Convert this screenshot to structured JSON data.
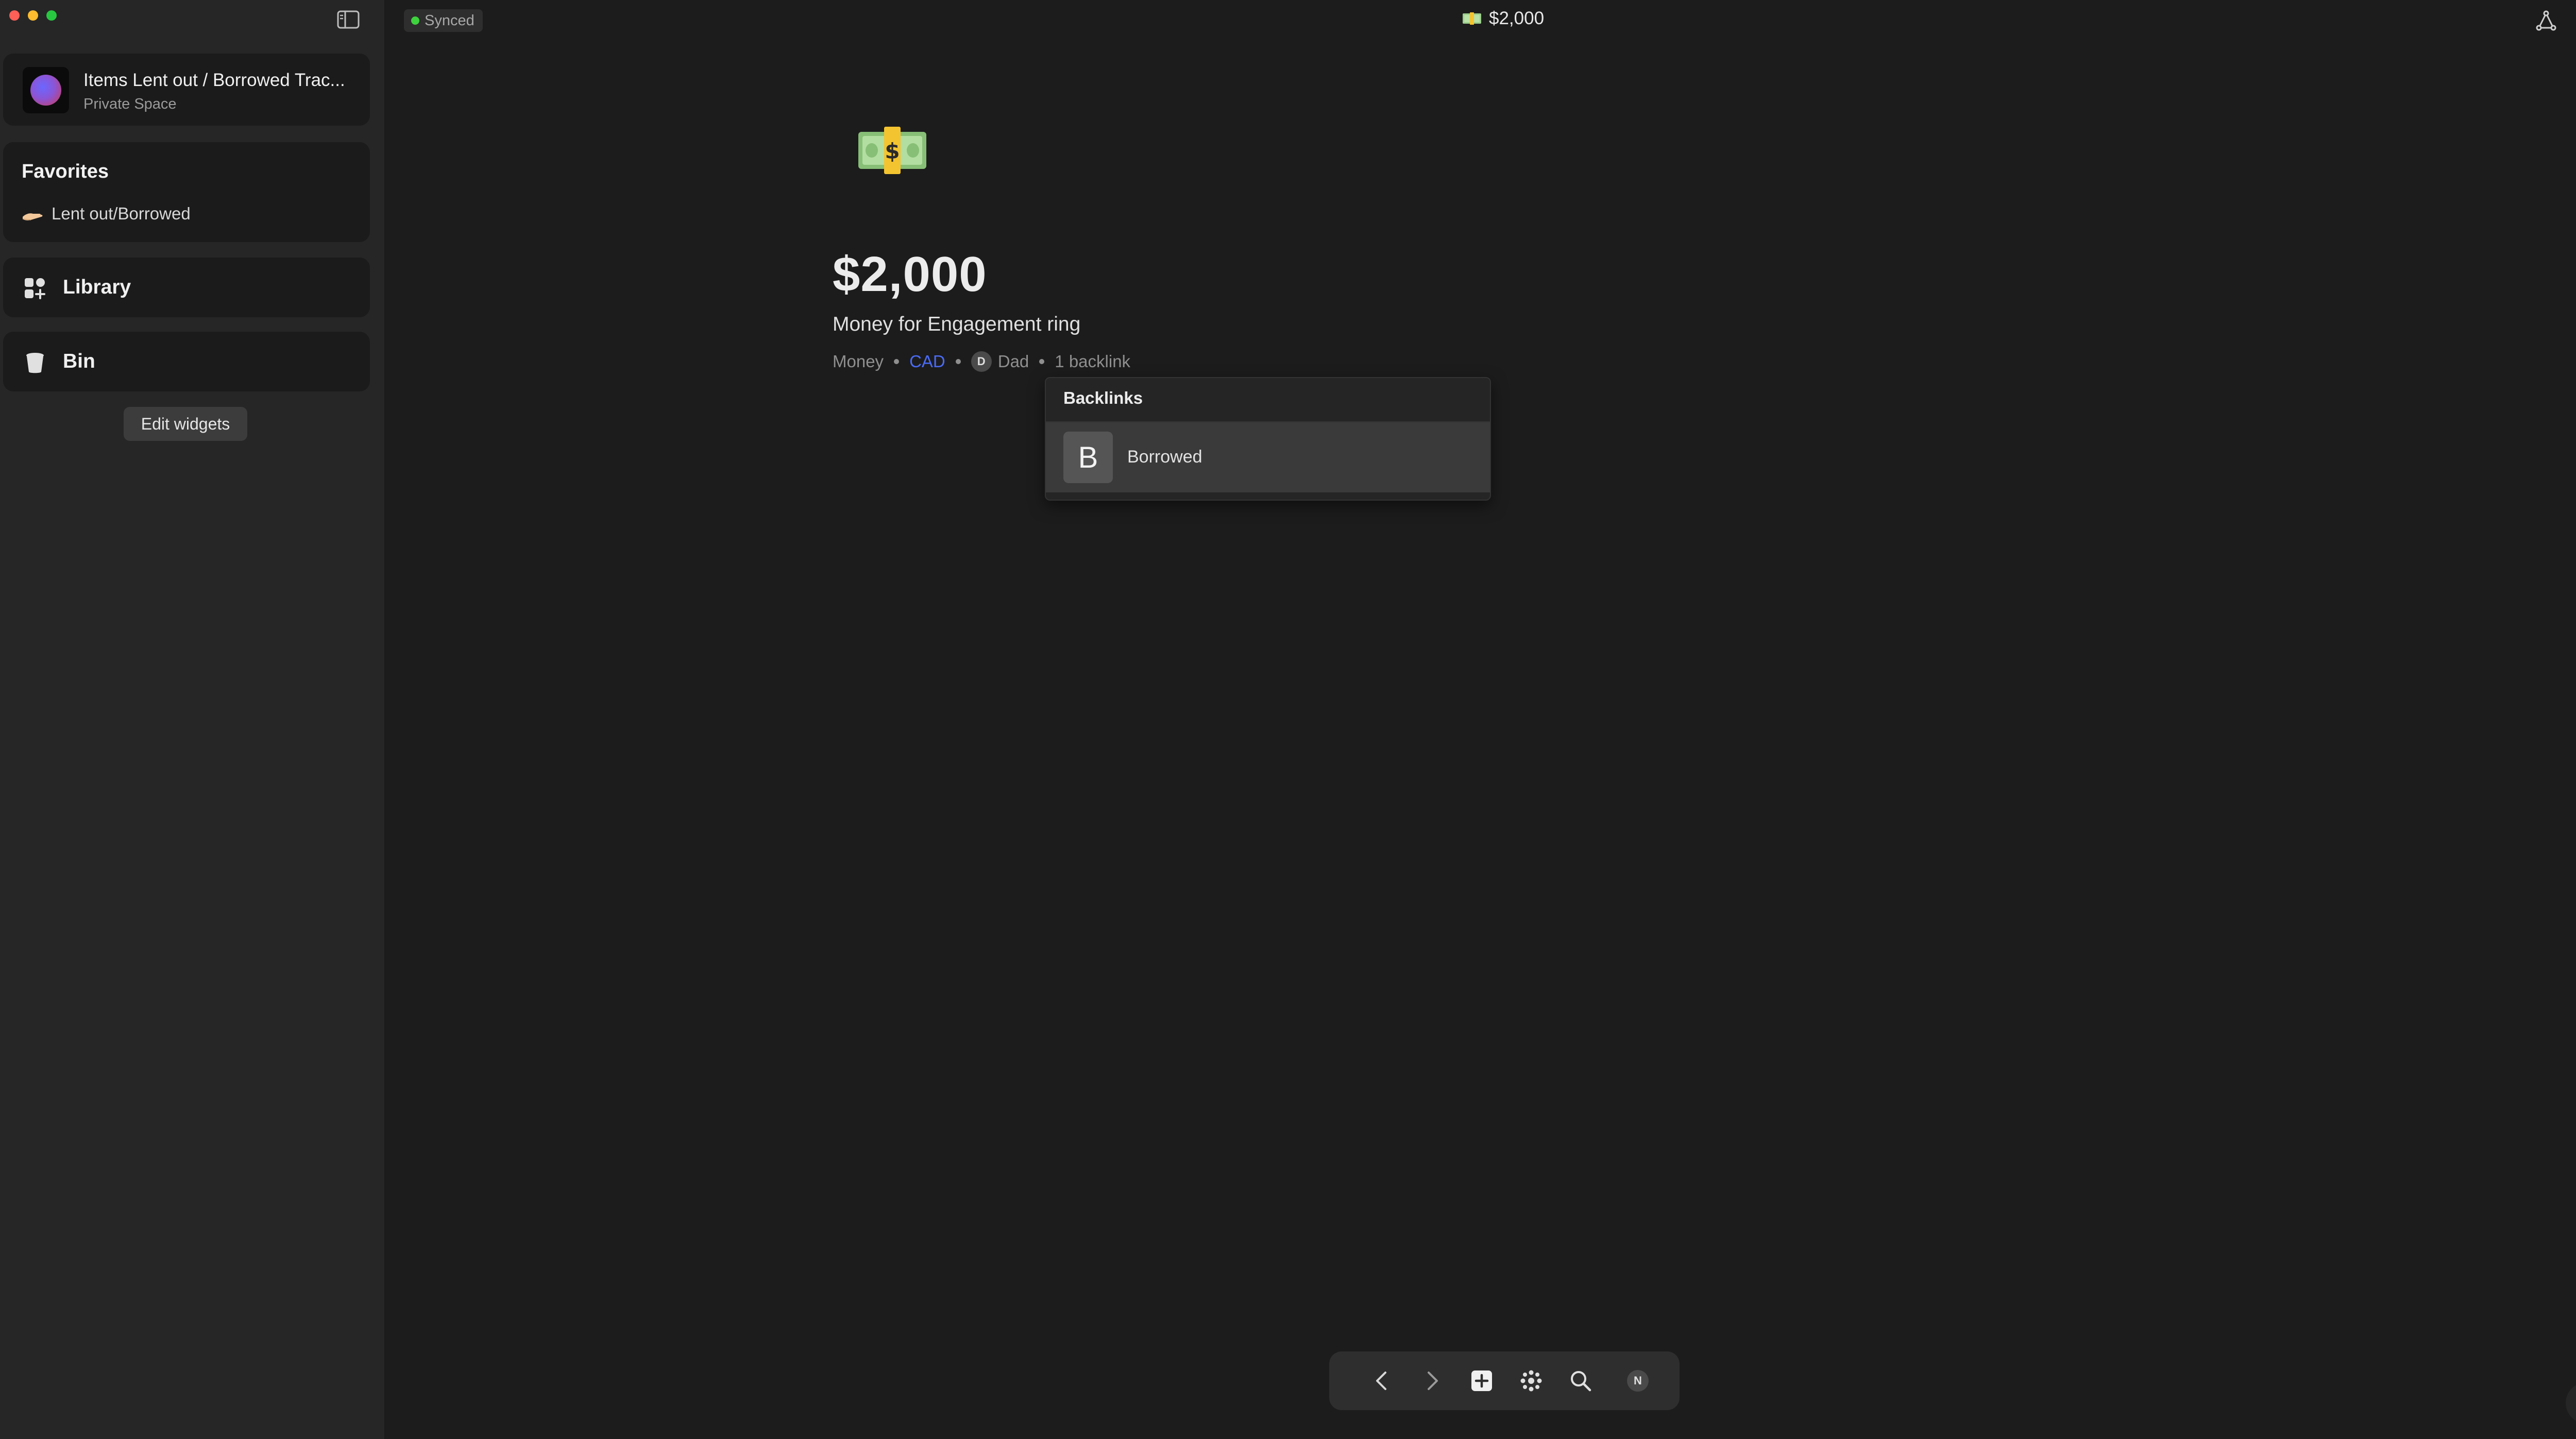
{
  "window": {
    "title": "$2,000"
  },
  "sidebar": {
    "space": {
      "name": "Items Lent out / Borrowed Trac...",
      "subtitle": "Private Space"
    },
    "favorites": {
      "title": "Favorites",
      "items": [
        {
          "label": "Lent out/Borrowed",
          "icon": "hand-palm-up-icon"
        }
      ]
    },
    "library_label": "Library",
    "bin_label": "Bin",
    "edit_widgets_label": "Edit widgets"
  },
  "topbar": {
    "sync_status": "Synced",
    "page_title": "$2,000",
    "page_icon": "money-banknote-icon"
  },
  "page": {
    "emoji": "money-banknote-icon",
    "title": "$2,000",
    "description": "Money for Engagement ring",
    "meta": {
      "type": "Money",
      "currency": "CAD",
      "person_initial": "D",
      "person": "Dad",
      "backlinks": "1 backlink"
    }
  },
  "backlinks_popup": {
    "title": "Backlinks",
    "items": [
      {
        "initial": "B",
        "label": "Borrowed"
      }
    ]
  },
  "toolbar": {
    "buttons": [
      "back-icon",
      "forward-icon",
      "plus-square-icon",
      "graph-dots-icon",
      "search-icon"
    ],
    "profile_initial": "N"
  },
  "help_label": "?",
  "colors": {
    "accent_link": "#4a6bf5",
    "sync_dot": "#3ed23e",
    "background": "#1c1c1c",
    "sidebar": "#262626"
  }
}
